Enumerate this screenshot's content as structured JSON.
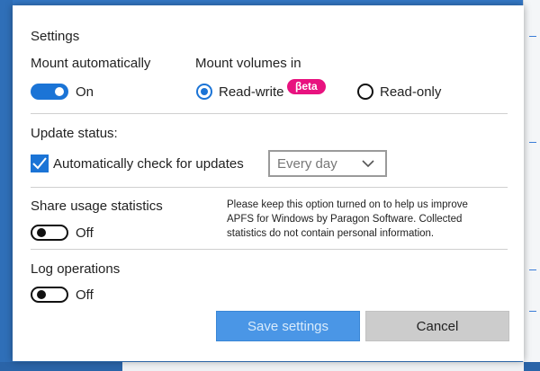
{
  "dialog": {
    "title": "Settings"
  },
  "mount": {
    "auto_label": "Mount automatically",
    "auto_state": "On",
    "volumes_label": "Mount volumes in",
    "options": [
      {
        "label": "Read-write",
        "selected": true,
        "badge": "βeta"
      },
      {
        "label": "Read-only",
        "selected": false
      }
    ]
  },
  "update": {
    "label": "Update status:",
    "check_label": "Automatically check for updates",
    "checked": true,
    "frequency": "Every day"
  },
  "share": {
    "label": "Share usage statistics",
    "state": "Off",
    "info": "Please keep this option turned on to help us improve APFS for Windows by Paragon Software. Collected statistics do not contain personal information."
  },
  "log": {
    "label": "Log operations",
    "state": "Off"
  },
  "buttons": {
    "save": "Save settings",
    "cancel": "Cancel"
  },
  "colors": {
    "accent": "#1b74d6",
    "beta": "#e8127f",
    "primary_button": "#4a96e6",
    "secondary_button": "#cccccc"
  }
}
